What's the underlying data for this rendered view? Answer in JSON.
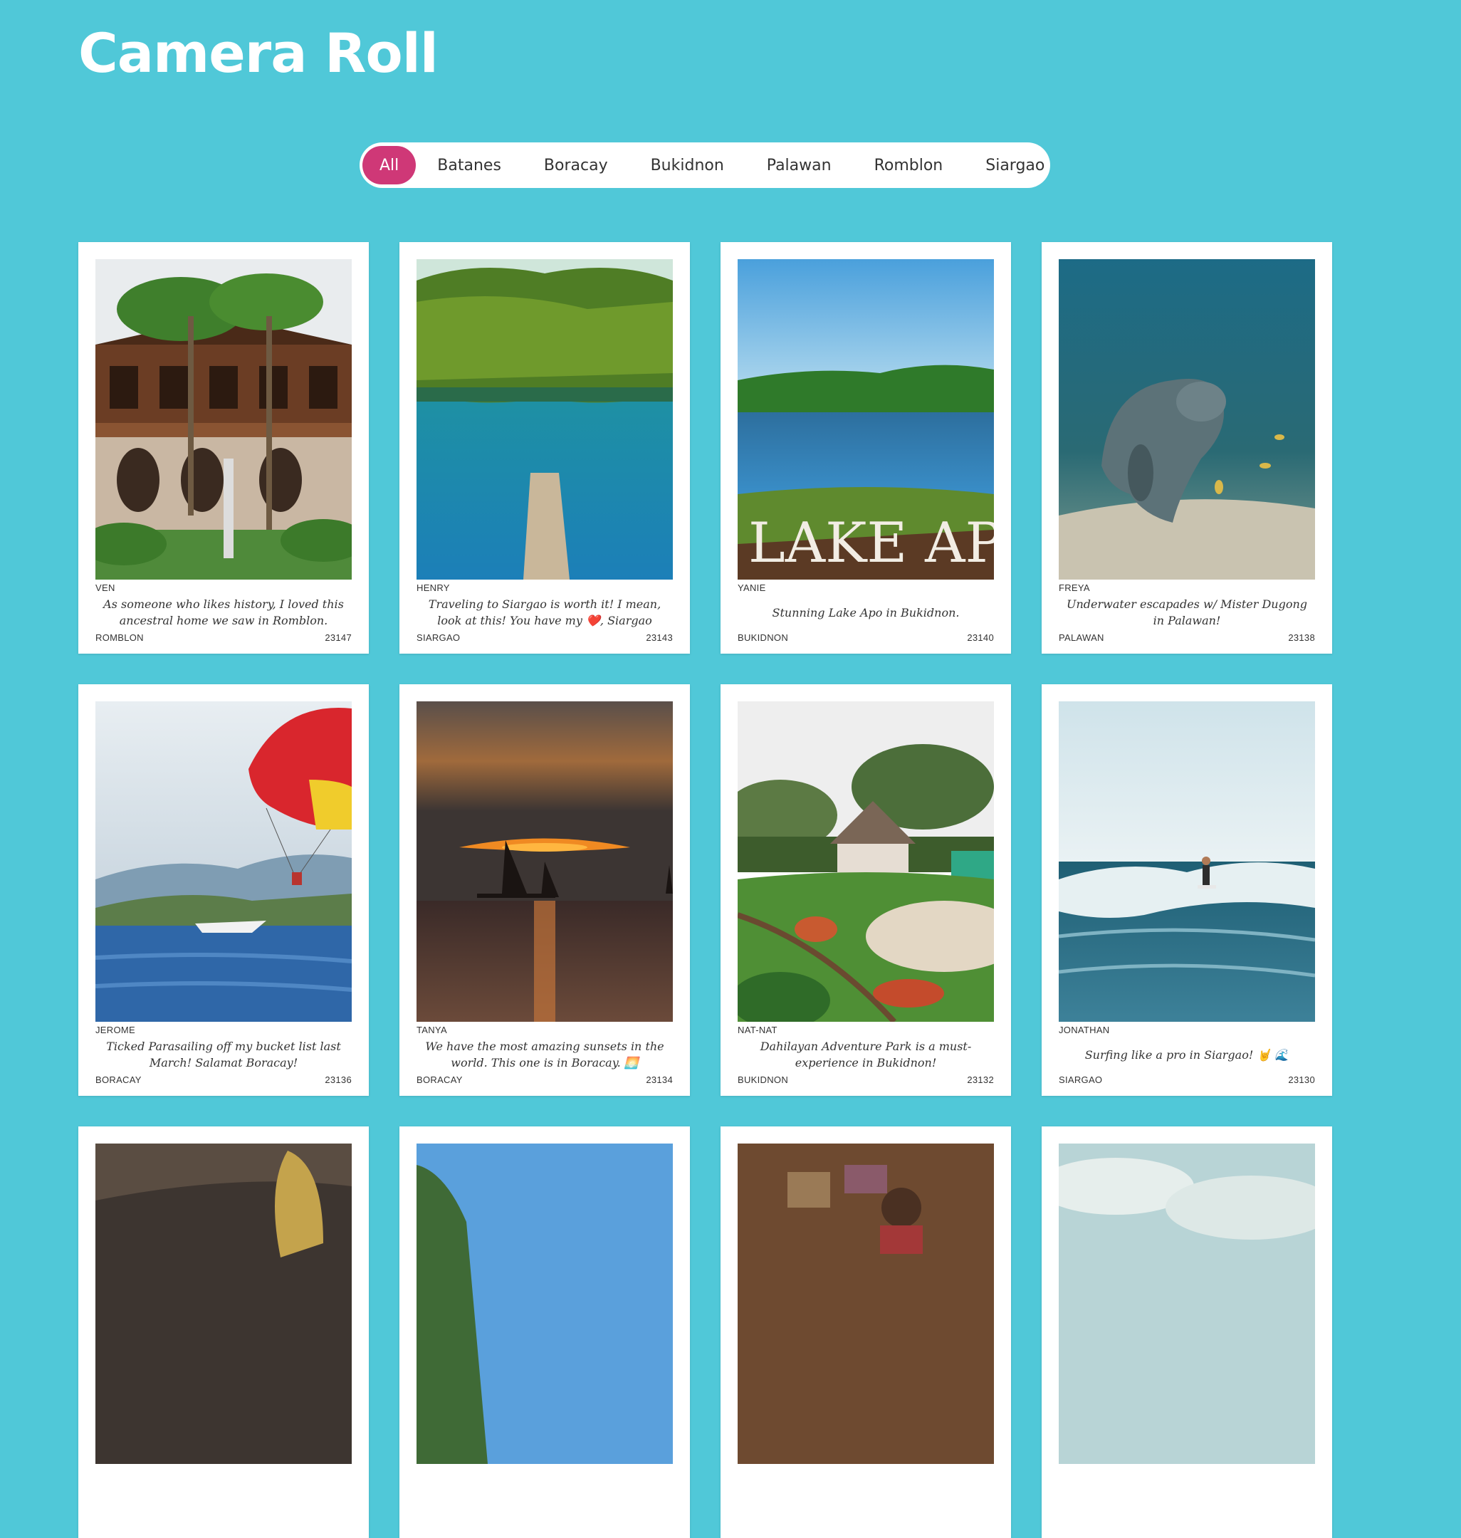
{
  "title": "Camera Roll",
  "filters": {
    "active": "All",
    "items": [
      "All",
      "Batanes",
      "Boracay",
      "Bukidnon",
      "Palawan",
      "Romblon",
      "Siargao"
    ]
  },
  "photos": [
    {
      "author": "VEN",
      "caption": "As someone who likes history, I loved this ancestral home we saw in Romblon.",
      "location": "ROMBLON",
      "id": "23147"
    },
    {
      "author": "HENRY",
      "caption": "Traveling to Siargao is worth it! I mean, look at this! You have my ❤️, Siargao",
      "location": "SIARGAO",
      "id": "23143"
    },
    {
      "author": "YANIE",
      "caption": "Stunning Lake Apo in Bukidnon.",
      "location": "BUKIDNON",
      "id": "23140"
    },
    {
      "author": "FREYA",
      "caption": "Underwater escapades w/ Mister Dugong in Palawan!",
      "location": "PALAWAN",
      "id": "23138"
    },
    {
      "author": "JEROME",
      "caption": "Ticked Parasailing off my bucket list last March! Salamat Boracay!",
      "location": "BORACAY",
      "id": "23136"
    },
    {
      "author": "TANYA",
      "caption": "We have the most amazing sunsets in the world. This one is in Boracay. 🌅",
      "location": "BORACAY",
      "id": "23134"
    },
    {
      "author": "NAT-NAT",
      "caption": "Dahilayan Adventure Park is a must-experience in Bukidnon!",
      "location": "BUKIDNON",
      "id": "23132"
    },
    {
      "author": "JONATHAN",
      "caption": "Surfing like a pro in Siargao! 🤘 🌊",
      "location": "SIARGAO",
      "id": "23130"
    }
  ]
}
